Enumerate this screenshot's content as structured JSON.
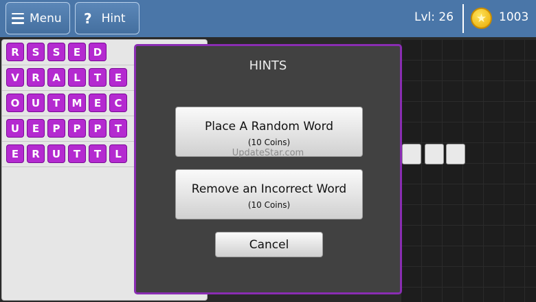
{
  "topbar": {
    "menu_label": "Menu",
    "hint_label": "Hint",
    "hint_icon": "?",
    "level_text": "Lvl: 26",
    "coins": "1003",
    "coin_icon": "★"
  },
  "words": [
    [
      "R",
      "S",
      "S",
      "E",
      "D"
    ],
    [
      "V",
      "R",
      "A",
      "L",
      "T",
      "E"
    ],
    [
      "O",
      "U",
      "T",
      "M",
      "E",
      "C"
    ],
    [
      "U",
      "E",
      "P",
      "P",
      "P",
      "T"
    ],
    [
      "E",
      "R",
      "U",
      "T",
      "T",
      "L"
    ]
  ],
  "modal": {
    "title": "HINTS",
    "option1": {
      "label": "Place A Random Word",
      "cost": "(10 Coins)"
    },
    "option2": {
      "label": "Remove an Incorrect Word",
      "cost": "(10 Coins)"
    },
    "cancel_label": "Cancel",
    "watermark": "UpdateStar.com"
  },
  "colors": {
    "topbar": "#4a76a8",
    "tile": "#b42ad0",
    "modal_border": "#8a2db3"
  }
}
